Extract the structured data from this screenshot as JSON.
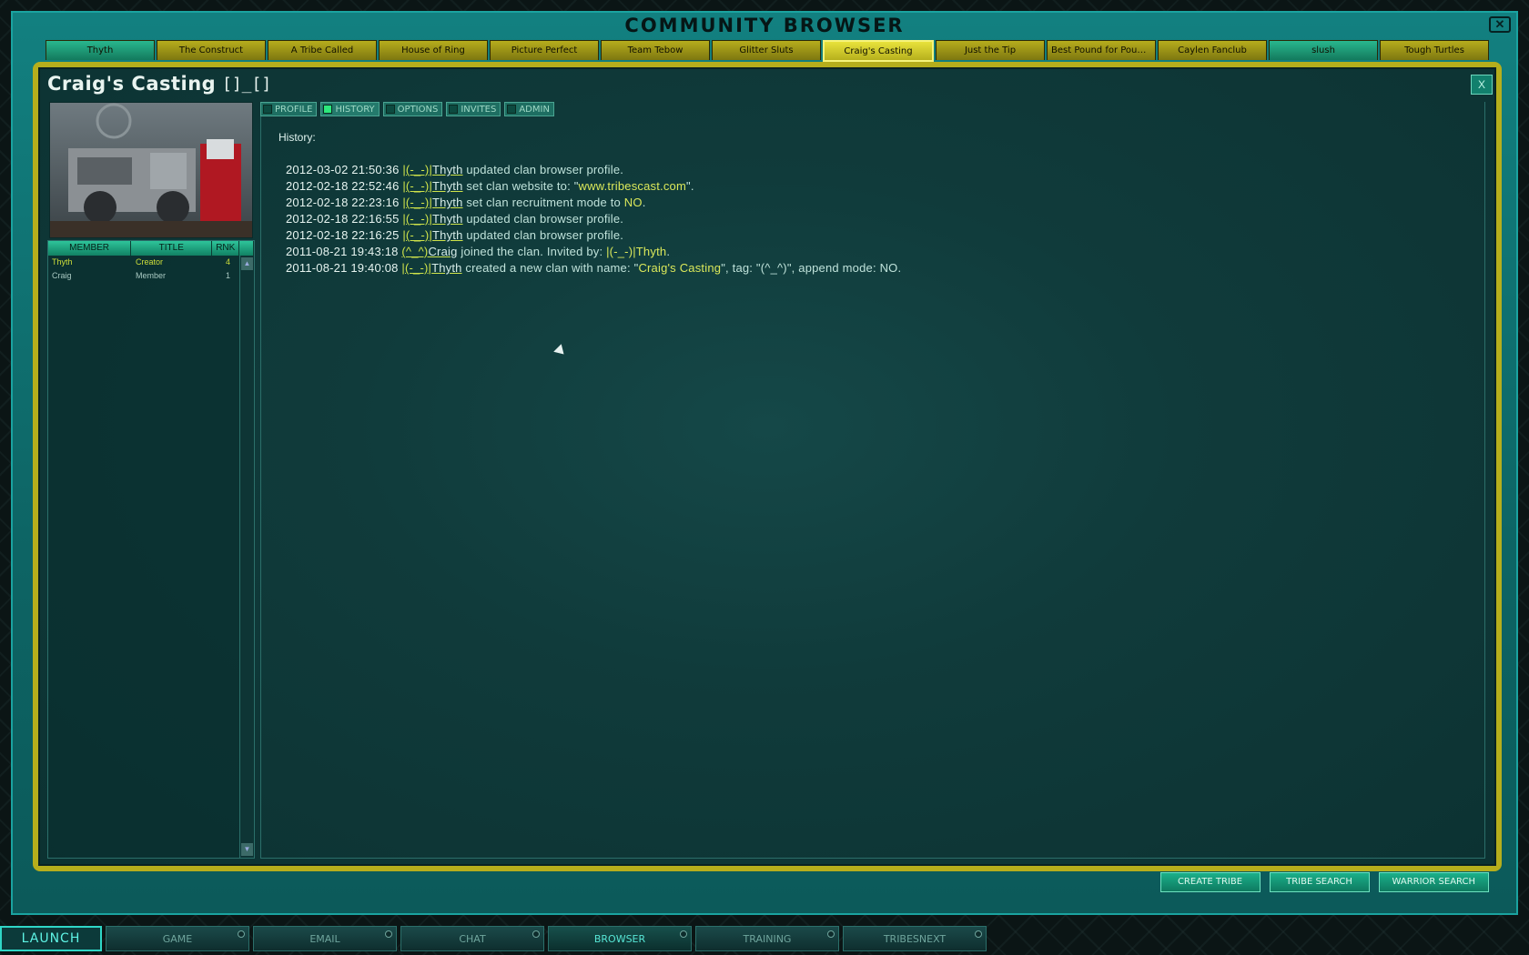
{
  "window": {
    "title": "COMMUNITY BROWSER",
    "close_glyph": "✕"
  },
  "clan_tabs": [
    {
      "label": "Thyth",
      "state": "green"
    },
    {
      "label": "The Construct",
      "state": "normal"
    },
    {
      "label": "A Tribe Called",
      "state": "normal"
    },
    {
      "label": "House of Ring",
      "state": "normal"
    },
    {
      "label": "Picture Perfect",
      "state": "normal"
    },
    {
      "label": "Team Tebow",
      "state": "normal"
    },
    {
      "label": "Glitter Sluts",
      "state": "normal"
    },
    {
      "label": "Craig's Casting",
      "state": "active"
    },
    {
      "label": "Just the Tip",
      "state": "normal"
    },
    {
      "label": "Best Pound for Pound...",
      "state": "normal"
    },
    {
      "label": "Caylen Fanclub",
      "state": "normal"
    },
    {
      "label": "slush",
      "state": "green"
    },
    {
      "label": "Tough Turtles",
      "state": "normal"
    }
  ],
  "clan": {
    "name": "Craig's Casting",
    "tag": "[]_[]",
    "close_label": "X"
  },
  "sub_tabs": [
    {
      "label": "PROFILE",
      "active": false
    },
    {
      "label": "HISTORY",
      "active": true
    },
    {
      "label": "OPTIONS",
      "active": false
    },
    {
      "label": "INVITES",
      "active": false
    },
    {
      "label": "ADMIN",
      "active": false
    }
  ],
  "members": {
    "headers": {
      "member": "MEMBER",
      "title": "TITLE",
      "rank": "RNK"
    },
    "rows": [
      {
        "member": "Thyth",
        "title": "Creator",
        "rank": "4",
        "style": "gold"
      },
      {
        "member": "Craig",
        "title": "Member",
        "rank": "1",
        "style": "gray"
      }
    ]
  },
  "history": {
    "label": "History:",
    "entries": [
      {
        "ts": "2012-03-02 21:50:36",
        "who_tag": "|(-_-)|",
        "who_name": "Thyth",
        "pre": " updated clan browser profile.",
        "val": "",
        "post": ""
      },
      {
        "ts": "2012-02-18 22:52:46",
        "who_tag": "|(-_-)|",
        "who_name": "Thyth",
        "pre": " set clan website to: \"",
        "val": "www.tribescast.com",
        "post": "\"."
      },
      {
        "ts": "2012-02-18 22:23:16",
        "who_tag": "|(-_-)|",
        "who_name": "Thyth",
        "pre": " set clan recruitment mode to ",
        "val": "NO",
        "post": "."
      },
      {
        "ts": "2012-02-18 22:16:55",
        "who_tag": "|(-_-)|",
        "who_name": "Thyth",
        "pre": " updated clan browser profile.",
        "val": "",
        "post": ""
      },
      {
        "ts": "2012-02-18 22:16:25",
        "who_tag": "|(-_-)|",
        "who_name": "Thyth",
        "pre": " updated clan browser profile.",
        "val": "",
        "post": ""
      },
      {
        "ts": "2011-08-21 19:43:18",
        "who_tag": "(^_^)",
        "who_name": "Craig",
        "pre": " joined the clan. Invited by: ",
        "val": "|(-_-)|Thyth",
        "post": "."
      },
      {
        "ts": "2011-08-21 19:40:08",
        "who_tag": "|(-_-)|",
        "who_name": "Thyth",
        "pre": " created a new clan with name: \"",
        "val": "Craig's Casting",
        "post": "\", tag: \"(^_^)\", append mode: NO."
      }
    ]
  },
  "buttons": {
    "create": "CREATE TRIBE",
    "tribe_search": "TRIBE SEARCH",
    "warrior_search": "WARRIOR SEARCH"
  },
  "taskbar": {
    "launch": "LAUNCH",
    "tabs": [
      {
        "label": "GAME",
        "active": false
      },
      {
        "label": "EMAIL",
        "active": false
      },
      {
        "label": "CHAT",
        "active": false
      },
      {
        "label": "BROWSER",
        "active": true
      },
      {
        "label": "TRAINING",
        "active": false
      },
      {
        "label": "TRIBESNEXT",
        "active": false
      }
    ]
  },
  "colors": {
    "accent": "#b6ae1c",
    "panel": "#0f6b6b",
    "active_check": "#2de87c"
  }
}
